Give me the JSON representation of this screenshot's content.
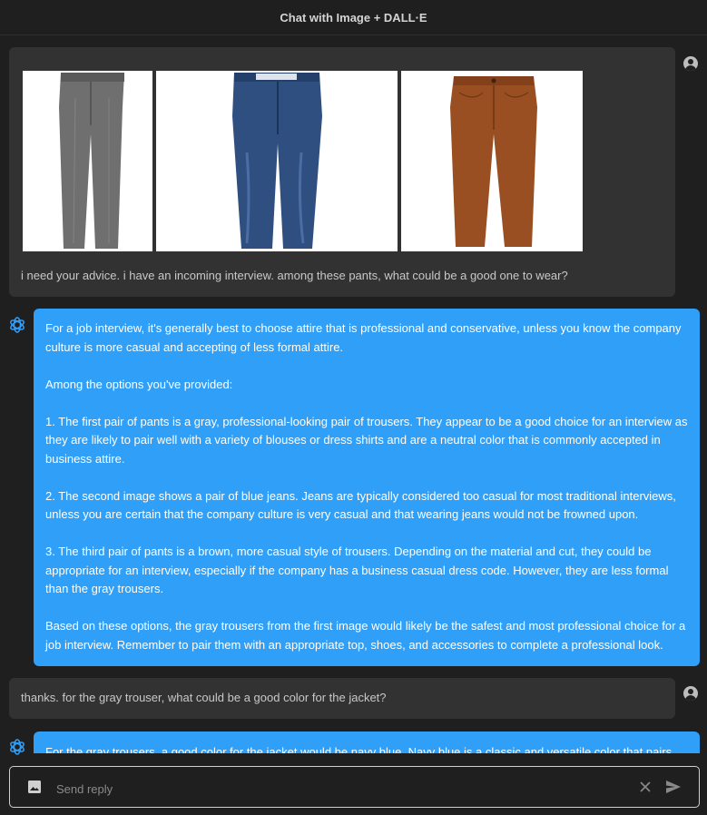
{
  "header": {
    "title": "Chat with Image + DALL·E"
  },
  "messages": {
    "user1": {
      "images": [
        "gray-trousers-image",
        "blue-jeans-image",
        "brown-trousers-image"
      ],
      "text": "i need your advice. i have an incoming interview. among these pants, what could be a good one to wear?"
    },
    "bot1": {
      "paragraphs": [
        "For a job interview, it's generally best to choose attire that is professional and conservative, unless you know the company culture is more casual and accepting of less formal attire.",
        "Among the options you've provided:",
        "1. The first pair of pants is a gray, professional-looking pair of trousers. They appear to be a good choice for an interview as they are likely to pair well with a variety of blouses or dress shirts and are a neutral color that is commonly accepted in business attire.",
        "2. The second image shows a pair of blue jeans. Jeans are typically considered too casual for most traditional interviews, unless you are certain that the company culture is very casual and that wearing jeans would not be frowned upon.",
        "3. The third pair of pants is a brown, more casual style of trousers. Depending on the material and cut, they could be appropriate for an interview, especially if the company has a business casual dress code. However, they are less formal than the gray trousers.",
        "Based on these options, the gray trousers from the first image would likely be the safest and most professional choice for a job interview. Remember to pair them with an appropriate top, shoes, and accessories to complete a professional look."
      ]
    },
    "user2": {
      "text": "thanks. for the gray trouser, what could be a good color for the jacket?"
    },
    "bot2": {
      "text": "For the gray trousers, a good color for the jacket would be navy blue. Navy blue is a classic and versatile color that pairs"
    }
  },
  "input": {
    "placeholder": "Send reply",
    "icons": {
      "attach": "image-icon",
      "clear": "close-icon",
      "send": "send-icon"
    }
  },
  "colors": {
    "background": "#1f1f1f",
    "user_bubble": "#323232",
    "bot_bubble": "#2f9ff8",
    "bot_icon": "#2f9ff8"
  }
}
